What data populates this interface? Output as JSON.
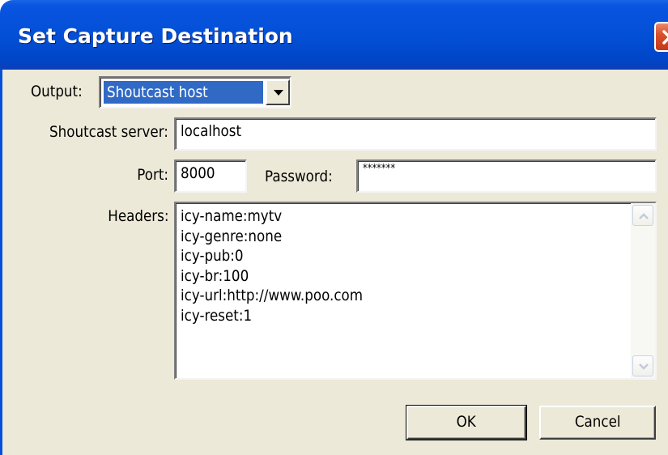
{
  "window": {
    "title": "Set Capture Destination",
    "close_icon": "close-icon"
  },
  "output": {
    "label": "Output:",
    "selected": "Shoutcast host"
  },
  "server": {
    "label": "Shoutcast server:",
    "value": "localhost"
  },
  "port": {
    "label": "Port:",
    "value": "8000"
  },
  "password": {
    "label": "Password:",
    "value": "*******"
  },
  "headers": {
    "label": "Headers:",
    "lines": [
      "icy-name:mytv",
      "icy-genre:none",
      "icy-pub:0",
      "icy-br:100",
      "icy-url:http://www.poo.com",
      "icy-reset:1"
    ]
  },
  "buttons": {
    "ok": "OK",
    "cancel": "Cancel"
  },
  "colors": {
    "titlebar": "#0350d6",
    "dialog_bg": "#ece9d8",
    "selection": "#316ac5",
    "close": "#d8522c"
  }
}
